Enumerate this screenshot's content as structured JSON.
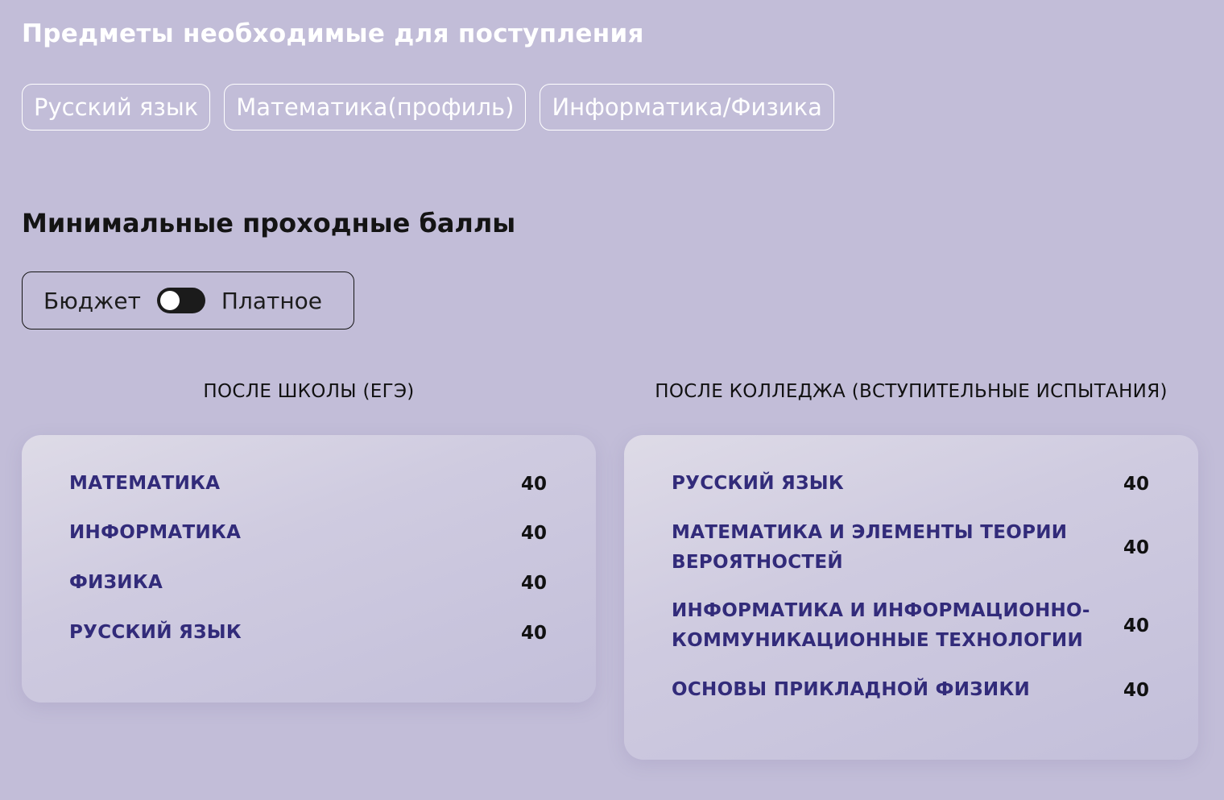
{
  "title": "Предметы необходимые для поступления",
  "subjects": [
    "Русский язык",
    "Математика(профиль)",
    "Информатика/Физика"
  ],
  "min_scores_title": "Минимальные проходные баллы",
  "toggle": {
    "left_label": "Бюджет",
    "right_label": "Платное",
    "state": "off"
  },
  "school": {
    "heading": "ПОСЛЕ ШКОЛЫ (ЕГЭ)",
    "rows": [
      {
        "name": "МАТЕМАТИКА",
        "score": "40"
      },
      {
        "name": "ИНФОРМАТИКА",
        "score": "40"
      },
      {
        "name": "ФИЗИКА",
        "score": "40"
      },
      {
        "name": "РУССКИЙ ЯЗЫК",
        "score": "40"
      }
    ]
  },
  "college": {
    "heading": "ПОСЛЕ КОЛЛЕДЖА (ВСТУПИТЕЛЬНЫЕ ИСПЫТАНИЯ)",
    "rows": [
      {
        "name": "РУССКИЙ ЯЗЫК",
        "score": "40"
      },
      {
        "name": "МАТЕМАТИКА И ЭЛЕМЕНТЫ ТЕОРИИ ВЕРОЯТНОСТЕЙ",
        "score": "40"
      },
      {
        "name": "ИНФОРМАТИКА И ИНФОРМАЦИОННО-КОММУНИКАЦИОННЫЕ ТЕХНОЛОГИИ",
        "score": "40"
      },
      {
        "name": "ОСНОВЫ ПРИКЛАДНОЙ ФИЗИКИ",
        "score": "40"
      }
    ]
  },
  "colors": {
    "background": "#c2bdd8",
    "subject_name": "#322b7a",
    "switch": "#1b1b1b"
  }
}
